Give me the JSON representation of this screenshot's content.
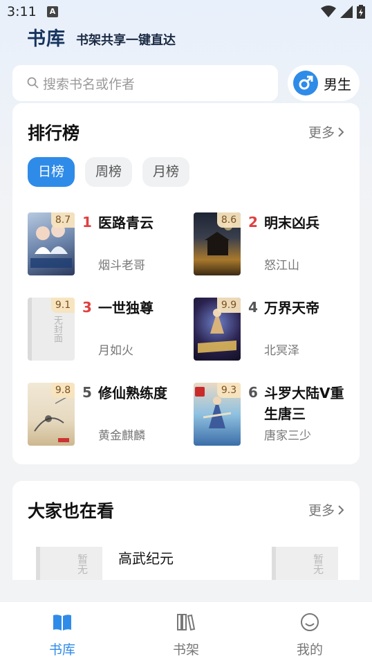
{
  "status_bar": {
    "time": "3:11",
    "badge": "A"
  },
  "header": {
    "brand": "书库",
    "slogan": "书架共享一键直达"
  },
  "search": {
    "placeholder": "搜索书名或作者"
  },
  "gender": {
    "label": "男生",
    "icon": "male-icon"
  },
  "ranking": {
    "title": "排行榜",
    "more": "更多",
    "tabs": [
      "日榜",
      "周榜",
      "月榜"
    ],
    "active_tab": "日榜",
    "books": [
      {
        "rank": "1",
        "title": "医路青云",
        "author": "烟斗老哥",
        "score": "8.7"
      },
      {
        "rank": "2",
        "title": "明末凶兵",
        "author": "怒江山",
        "score": "8.6"
      },
      {
        "rank": "3",
        "title": "一世独尊",
        "author": "月如火",
        "score": "9.1"
      },
      {
        "rank": "4",
        "title": "万界天帝",
        "author": "北冥泽",
        "score": "9.9"
      },
      {
        "rank": "5",
        "title": "修仙熟练度",
        "author": "黄金麒麟",
        "score": "9.8"
      },
      {
        "rank": "6",
        "title": "斗罗大陆V重生唐三",
        "author": "唐家三少",
        "score": "9.3"
      }
    ],
    "cover_texts": {
      "placeholder": "无封面"
    }
  },
  "also": {
    "title": "大家也在看",
    "more": "更多",
    "book_title": "高武纪元",
    "cover_placeholder": "暂无"
  },
  "nav": {
    "items": [
      {
        "label": "书库",
        "icon": "library-icon"
      },
      {
        "label": "书架",
        "icon": "bookshelf-icon"
      },
      {
        "label": "我的",
        "icon": "profile-icon"
      }
    ]
  },
  "colors": {
    "accent": "#2f8be8",
    "rank_top": "#e04040",
    "brand": "#16345e"
  }
}
